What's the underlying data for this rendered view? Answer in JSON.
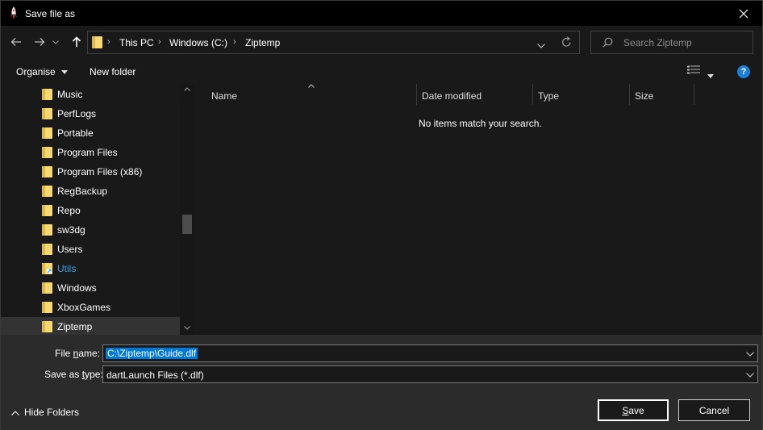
{
  "window": {
    "title": "Save file as"
  },
  "breadcrumb": [
    "This PC",
    "Windows (C:)",
    "Ziptemp"
  ],
  "search": {
    "placeholder": "Search Ziptemp"
  },
  "toolbar": {
    "organise": "Organise",
    "new_folder": "New folder",
    "help": "?"
  },
  "tree": {
    "items": [
      {
        "label": "Music"
      },
      {
        "label": "PerfLogs"
      },
      {
        "label": "Portable"
      },
      {
        "label": "Program Files"
      },
      {
        "label": "Program Files (x86)"
      },
      {
        "label": "RegBackup"
      },
      {
        "label": "Repo"
      },
      {
        "label": "sw3dg"
      },
      {
        "label": "Users"
      },
      {
        "label": "Utils"
      },
      {
        "label": "Windows"
      },
      {
        "label": "XboxGames"
      },
      {
        "label": "Ziptemp"
      }
    ]
  },
  "filelist": {
    "columns": [
      "Name",
      "Date modified",
      "Type",
      "Size"
    ],
    "empty_message": "No items match your search."
  },
  "form": {
    "file_name_label_prefix": "File ",
    "file_name_label_key": "n",
    "file_name_label_suffix": "ame:",
    "file_name_value": "C:\\Ziptemp\\Guide.dlf",
    "save_type_label_prefix": "Save as ",
    "save_type_label_key": "t",
    "save_type_label_suffix": "ype:",
    "save_type_value": "dartLaunch Files (*.dlf)"
  },
  "buttons": {
    "save_key": "S",
    "save_rest": "ave",
    "cancel": "Cancel",
    "hide_folders": "Hide Folders"
  },
  "colors": {
    "accent": "#0078d7",
    "folder": "#f8d775",
    "link": "#3aa0e8",
    "help": "#1e7fd6"
  }
}
